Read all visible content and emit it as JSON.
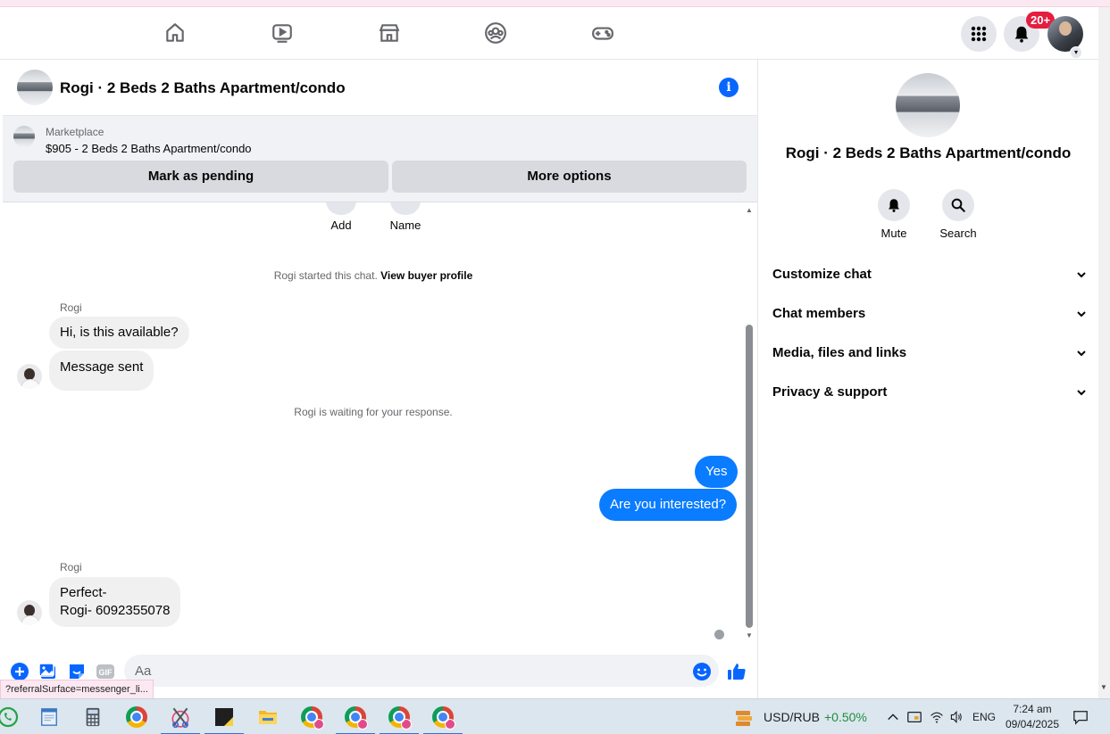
{
  "navbar": {
    "notifications_badge": "20+"
  },
  "chat": {
    "title": "Rogi · 2 Beds 2 Baths Apartment/condo",
    "marketplace": {
      "label": "Marketplace",
      "listing": "$905 - 2 Beds 2 Baths Apartment/condo",
      "pending_button": "Mark as pending",
      "more_button": "More options"
    },
    "quick_actions": [
      "Add",
      "Name"
    ],
    "system_started_prefix": "Rogi started this chat.",
    "system_started_link": "View buyer profile",
    "sender_name_1": "Rogi",
    "msg_in_1": "Hi, is this available?",
    "msg_in_2": "Message sent",
    "system_waiting": "Rogi is waiting for your response.",
    "msg_out_1": "Yes",
    "msg_out_2": "Are you interested?",
    "sender_name_2": "Rogi",
    "msg_in_3_line1": "Perfect-",
    "msg_in_3_line2": "Rogi- 6092355078",
    "composer_placeholder": "Aa",
    "gif_label": "GIF"
  },
  "status_url": "?referralSurface=messenger_li...",
  "right_panel": {
    "title": "Rogi · 2 Beds 2 Baths Apartment/condo",
    "mute_label": "Mute",
    "search_label": "Search",
    "sections": [
      "Customize chat",
      "Chat members",
      "Media, files and links",
      "Privacy & support"
    ]
  },
  "taskbar": {
    "currency_pair": "USD/RUB",
    "currency_change": "+0.50%",
    "language": "ENG",
    "time": "7:24 am",
    "date": "09/04/2025"
  },
  "colors": {
    "accent": "#0866ff",
    "outgoing_bubble": "#0a7cff",
    "incoming_bubble": "#f0f0f0",
    "badge": "#e41e3f",
    "positive_change": "#1e8e3e"
  }
}
